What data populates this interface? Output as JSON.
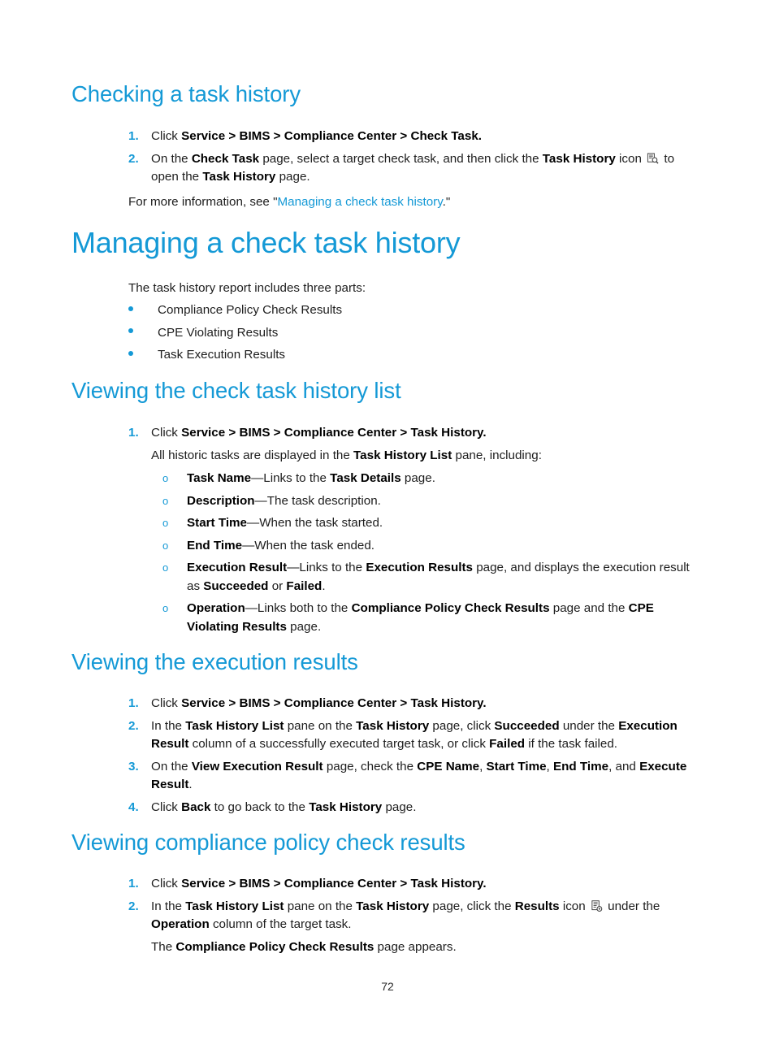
{
  "document": {
    "page_number": "72",
    "accent_color": "#1499d6",
    "text_color": "#1d1d1d"
  },
  "sections": [
    {
      "id": "checking-a-task-history",
      "level": "h2",
      "heading": "Checking a task history",
      "steps": [
        {
          "number": "1.",
          "parts": [
            {
              "t": "Click ",
              "s": "plain"
            },
            {
              "t": "Service > BIMS > Compliance Center > Check Task.",
              "s": "bold"
            }
          ]
        },
        {
          "number": "2.",
          "parts": [
            {
              "t": "On the ",
              "s": "plain"
            },
            {
              "t": "Check Task",
              "s": "bold"
            },
            {
              "t": " page, select a target check task, and then click the ",
              "s": "plain"
            },
            {
              "t": "Task History",
              "s": "bold"
            },
            {
              "t": " icon ",
              "s": "plain"
            },
            {
              "t": "task-history-icon",
              "s": "icon"
            },
            {
              "t": " to open the ",
              "s": "plain"
            },
            {
              "t": "Task History",
              "s": "bold"
            },
            {
              "t": " page.",
              "s": "plain"
            }
          ]
        }
      ],
      "trailing_paragraph": [
        {
          "t": "For more information, see \"",
          "s": "plain"
        },
        {
          "t": "Managing a check task history",
          "s": "xref"
        },
        {
          "t": ".\"",
          "s": "plain"
        }
      ]
    },
    {
      "id": "managing-a-check-task-history",
      "level": "h1",
      "heading": "Managing a check task history",
      "intro": "The task history report includes three parts:",
      "bullets": [
        "Compliance Policy Check Results",
        "CPE Violating Results",
        "Task Execution Results"
      ]
    },
    {
      "id": "viewing-the-check-task-history-list",
      "level": "h2",
      "heading": "Viewing the check task history list",
      "steps": [
        {
          "number": "1.",
          "parts": [
            {
              "t": "Click ",
              "s": "plain"
            },
            {
              "t": "Service > BIMS > Compliance Center > Task History.",
              "s": "bold"
            }
          ],
          "continuation": [
            {
              "t": "All historic tasks are displayed in the ",
              "s": "plain"
            },
            {
              "t": "Task History List",
              "s": "bold"
            },
            {
              "t": " pane, including:",
              "s": "plain"
            }
          ],
          "subitems": [
            [
              {
                "t": "Task Name",
                "s": "bold"
              },
              {
                "t": "—Links to the ",
                "s": "plain"
              },
              {
                "t": "Task Details",
                "s": "bold"
              },
              {
                "t": " page.",
                "s": "plain"
              }
            ],
            [
              {
                "t": "Description",
                "s": "bold"
              },
              {
                "t": "—The task description.",
                "s": "plain"
              }
            ],
            [
              {
                "t": "Start Time",
                "s": "bold"
              },
              {
                "t": "—When the task started.",
                "s": "plain"
              }
            ],
            [
              {
                "t": "End Time",
                "s": "bold"
              },
              {
                "t": "—When the task ended.",
                "s": "plain"
              }
            ],
            [
              {
                "t": "Execution Result",
                "s": "bold"
              },
              {
                "t": "—Links to the ",
                "s": "plain"
              },
              {
                "t": "Execution Results",
                "s": "bold"
              },
              {
                "t": " page, and displays the execution result as ",
                "s": "plain"
              },
              {
                "t": "Succeeded",
                "s": "bold"
              },
              {
                "t": " or ",
                "s": "plain"
              },
              {
                "t": "Failed",
                "s": "bold"
              },
              {
                "t": ".",
                "s": "plain"
              }
            ],
            [
              {
                "t": "Operation",
                "s": "bold"
              },
              {
                "t": "—Links both to the ",
                "s": "plain"
              },
              {
                "t": "Compliance Policy Check Results",
                "s": "bold"
              },
              {
                "t": " page and the ",
                "s": "plain"
              },
              {
                "t": "CPE Violating Results",
                "s": "bold"
              },
              {
                "t": " page.",
                "s": "plain"
              }
            ]
          ]
        }
      ]
    },
    {
      "id": "viewing-the-execution-results",
      "level": "h2",
      "heading": "Viewing the execution results",
      "steps": [
        {
          "number": "1.",
          "parts": [
            {
              "t": "Click ",
              "s": "plain"
            },
            {
              "t": "Service > BIMS > Compliance Center > Task History.",
              "s": "bold"
            }
          ]
        },
        {
          "number": "2.",
          "parts": [
            {
              "t": "In the ",
              "s": "plain"
            },
            {
              "t": "Task History List",
              "s": "bold"
            },
            {
              "t": " pane on the ",
              "s": "plain"
            },
            {
              "t": "Task History",
              "s": "bold"
            },
            {
              "t": " page, click ",
              "s": "plain"
            },
            {
              "t": "Succeeded",
              "s": "bold"
            },
            {
              "t": " under the ",
              "s": "plain"
            },
            {
              "t": "Execution Result",
              "s": "bold"
            },
            {
              "t": " column of a successfully executed target task, or click ",
              "s": "plain"
            },
            {
              "t": "Failed",
              "s": "bold"
            },
            {
              "t": " if the task failed.",
              "s": "plain"
            }
          ]
        },
        {
          "number": "3.",
          "parts": [
            {
              "t": "On the ",
              "s": "plain"
            },
            {
              "t": "View Execution Result",
              "s": "bold"
            },
            {
              "t": " page, check the ",
              "s": "plain"
            },
            {
              "t": "CPE Name",
              "s": "bold"
            },
            {
              "t": ", ",
              "s": "plain"
            },
            {
              "t": "Start Time",
              "s": "bold"
            },
            {
              "t": ", ",
              "s": "plain"
            },
            {
              "t": "End Time",
              "s": "bold"
            },
            {
              "t": ", and ",
              "s": "plain"
            },
            {
              "t": "Execute Result",
              "s": "bold"
            },
            {
              "t": ".",
              "s": "plain"
            }
          ]
        },
        {
          "number": "4.",
          "parts": [
            {
              "t": "Click ",
              "s": "plain"
            },
            {
              "t": "Back",
              "s": "bold"
            },
            {
              "t": " to go back to the ",
              "s": "plain"
            },
            {
              "t": "Task History",
              "s": "bold"
            },
            {
              "t": " page.",
              "s": "plain"
            }
          ]
        }
      ]
    },
    {
      "id": "viewing-compliance-policy-check-results",
      "level": "h2",
      "heading": "Viewing compliance policy check results",
      "steps": [
        {
          "number": "1.",
          "parts": [
            {
              "t": "Click ",
              "s": "plain"
            },
            {
              "t": "Service > BIMS > Compliance Center > Task History.",
              "s": "bold"
            }
          ]
        },
        {
          "number": "2.",
          "parts": [
            {
              "t": "In the ",
              "s": "plain"
            },
            {
              "t": "Task History List",
              "s": "bold"
            },
            {
              "t": " pane on the ",
              "s": "plain"
            },
            {
              "t": "Task History",
              "s": "bold"
            },
            {
              "t": " page, click the ",
              "s": "plain"
            },
            {
              "t": "Results",
              "s": "bold"
            },
            {
              "t": " icon ",
              "s": "plain"
            },
            {
              "t": "results-icon",
              "s": "icon"
            },
            {
              "t": " under the ",
              "s": "plain"
            },
            {
              "t": "Operation",
              "s": "bold"
            },
            {
              "t": " column of the target task.",
              "s": "plain"
            }
          ],
          "continuation": [
            {
              "t": "The ",
              "s": "plain"
            },
            {
              "t": "Compliance Policy Check Results",
              "s": "bold"
            },
            {
              "t": " page appears.",
              "s": "plain"
            }
          ]
        }
      ]
    }
  ]
}
